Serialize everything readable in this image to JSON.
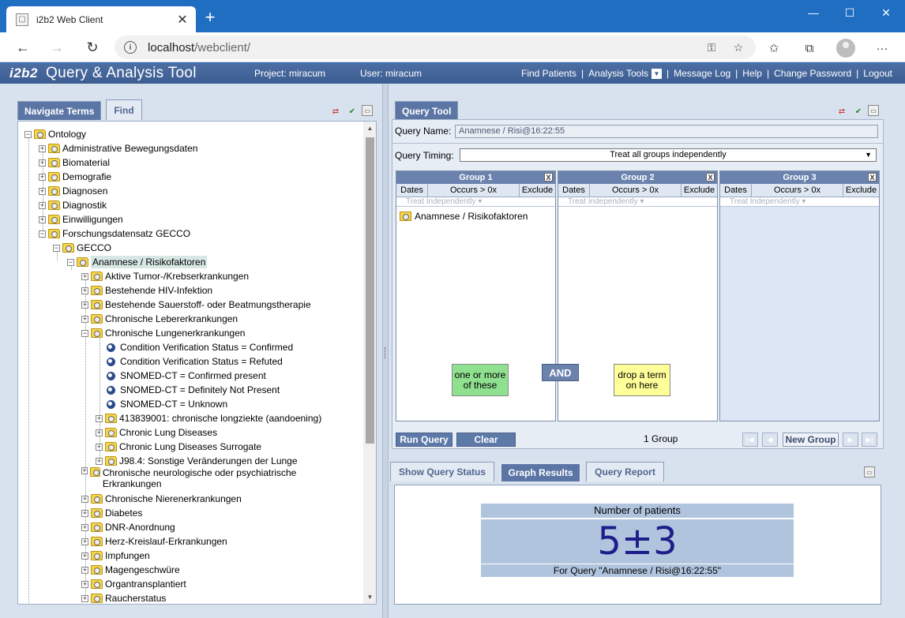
{
  "browser": {
    "tab_title": "i2b2 Web Client",
    "url_host": "localhost",
    "url_path": "/webclient/"
  },
  "header": {
    "logo": "i2b2",
    "title": "Query & Analysis Tool",
    "project": "Project: miracum",
    "user": "User: miracum",
    "nav": [
      "Find Patients",
      "Analysis Tools",
      "Message Log",
      "Help",
      "Change Password",
      "Logout"
    ]
  },
  "left_panel": {
    "tabs": [
      "Navigate Terms",
      "Find"
    ],
    "tree": [
      {
        "label": "Ontology",
        "icon": "folder"
      },
      {
        "label": "Administrative Bewegungsdaten",
        "icon": "folder"
      },
      {
        "label": "Biomaterial",
        "icon": "folder"
      },
      {
        "label": "Demografie",
        "icon": "folder"
      },
      {
        "label": "Diagnosen",
        "icon": "folder"
      },
      {
        "label": "Diagnostik",
        "icon": "folder"
      },
      {
        "label": "Einwilligungen",
        "icon": "folder"
      },
      {
        "label": "Forschungsdatensatz GECCO",
        "icon": "folder"
      },
      {
        "label": "GECCO",
        "icon": "folder"
      },
      {
        "label": "Anamnese / Risikofaktoren",
        "icon": "folder"
      },
      {
        "label": "Aktive Tumor-/Krebserkrankungen",
        "icon": "folder"
      },
      {
        "label": "Bestehende HIV-Infektion",
        "icon": "folder"
      },
      {
        "label": "Bestehende Sauerstoff- oder Beatmungstherapie",
        "icon": "folder"
      },
      {
        "label": "Chronische Lebererkrankungen",
        "icon": "folder"
      },
      {
        "label": "Chronische Lungenerkrankungen",
        "icon": "folder"
      },
      {
        "label": "Condition Verification Status = Confirmed",
        "icon": "leaf"
      },
      {
        "label": "Condition Verification Status = Refuted",
        "icon": "leaf"
      },
      {
        "label": "SNOMED-CT = Confirmed present",
        "icon": "leaf"
      },
      {
        "label": "SNOMED-CT = Definitely Not Present",
        "icon": "leaf"
      },
      {
        "label": "SNOMED-CT = Unknown",
        "icon": "leaf"
      },
      {
        "label": "413839001: chronische longziekte (aandoening)",
        "icon": "folder"
      },
      {
        "label": "Chronic Lung Diseases",
        "icon": "folder"
      },
      {
        "label": "Chronic Lung Diseases Surrogate",
        "icon": "folder"
      },
      {
        "label": "J98.4: Sonstige Veränderungen der Lunge",
        "icon": "folder"
      },
      {
        "label": "Chronische neurologische oder psychiatrische Erkrankungen",
        "icon": "folder"
      },
      {
        "label": "Chronische Nierenerkrankungen",
        "icon": "folder"
      },
      {
        "label": "Diabetes",
        "icon": "folder"
      },
      {
        "label": "DNR-Anordnung",
        "icon": "folder"
      },
      {
        "label": "Herz-Kreislauf-Erkrankungen",
        "icon": "folder"
      },
      {
        "label": "Impfungen",
        "icon": "folder"
      },
      {
        "label": "Magengeschwüre",
        "icon": "folder"
      },
      {
        "label": "Organtransplantiert",
        "icon": "folder"
      },
      {
        "label": "Raucherstatus",
        "icon": "folder"
      }
    ]
  },
  "query_tool": {
    "tab": "Query Tool",
    "name_label": "Query Name:",
    "name_value": "Anamnese / Risi@16:22:55",
    "timing_label": "Query Timing:",
    "timing_value": "Treat all groups independently",
    "group_cols": {
      "dates": "Dates",
      "occurs": "Occurs > 0x",
      "exclude": "Exclude"
    },
    "treat": "Treat Independently",
    "groups": [
      {
        "title": "Group 1",
        "item": "Anamnese / Risikofaktoren"
      },
      {
        "title": "Group 2"
      },
      {
        "title": "Group 3"
      }
    ],
    "hint_left": "one or more of these",
    "and_label": "AND",
    "hint_right": "drop a term on here",
    "run_label": "Run Query",
    "clear_label": "Clear",
    "group_count": "1 Group",
    "new_group_label": "New Group"
  },
  "results": {
    "tabs": [
      "Show Query Status",
      "Graph Results",
      "Query Report"
    ],
    "heading": "Number of patients",
    "value": "5±3",
    "footer": "For Query \"Anamnese / Risi@16:22:55\""
  },
  "colors": {
    "header_bg": "#3c5d92",
    "active_tab": "#5b76a5",
    "hint_green": "#8fe08f",
    "hint_yellow": "#ffff99",
    "result_bg": "#b0c4de",
    "result_value": "#1e1e8a"
  }
}
